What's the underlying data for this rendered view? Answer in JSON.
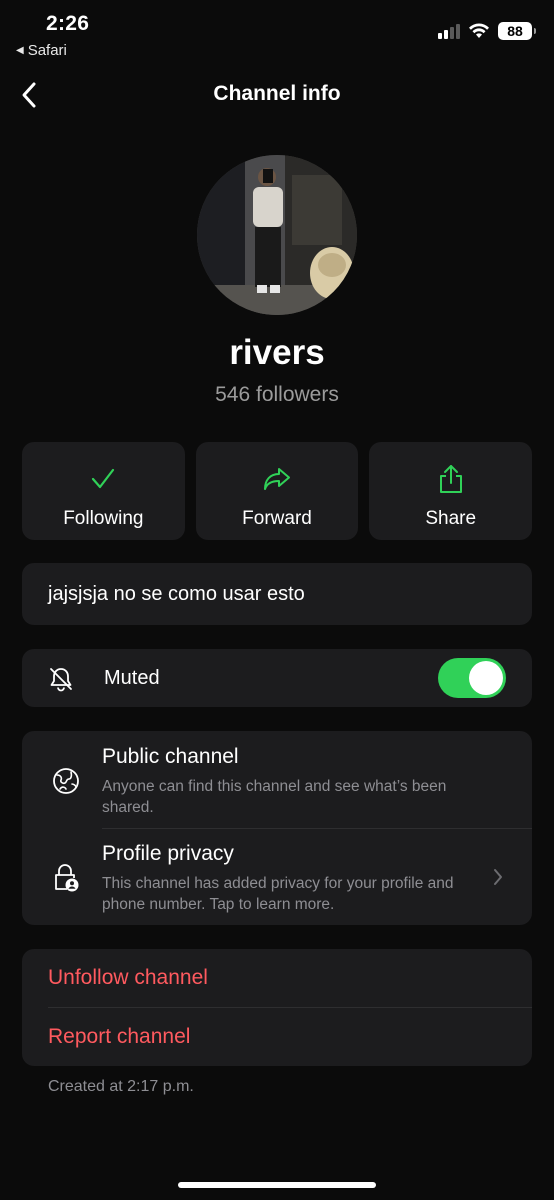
{
  "status": {
    "time": "2:26",
    "back_app": "Safari",
    "battery": "88"
  },
  "nav": {
    "title": "Channel info"
  },
  "channel": {
    "name": "rivers",
    "followers": "546 followers"
  },
  "actions": [
    {
      "label": "Following",
      "icon": "checkmark-icon"
    },
    {
      "label": "Forward",
      "icon": "forward-arrow-icon"
    },
    {
      "label": "Share",
      "icon": "share-icon"
    }
  ],
  "description": "jajsjsja no se como usar esto",
  "muted": {
    "label": "Muted",
    "enabled": true
  },
  "privacy": {
    "public": {
      "title": "Public channel",
      "subtitle": "Anyone can find this channel and see what’s been shared."
    },
    "profile": {
      "title": "Profile privacy",
      "subtitle": "This channel has added privacy for your profile and phone number. Tap to learn more."
    }
  },
  "danger": {
    "unfollow": "Unfollow channel",
    "report": "Report channel"
  },
  "created": "Created at 2:17 p.m.",
  "colors": {
    "accent_green": "#30d158",
    "danger_red": "#ff5a5f",
    "card_bg": "#1c1c1e"
  }
}
